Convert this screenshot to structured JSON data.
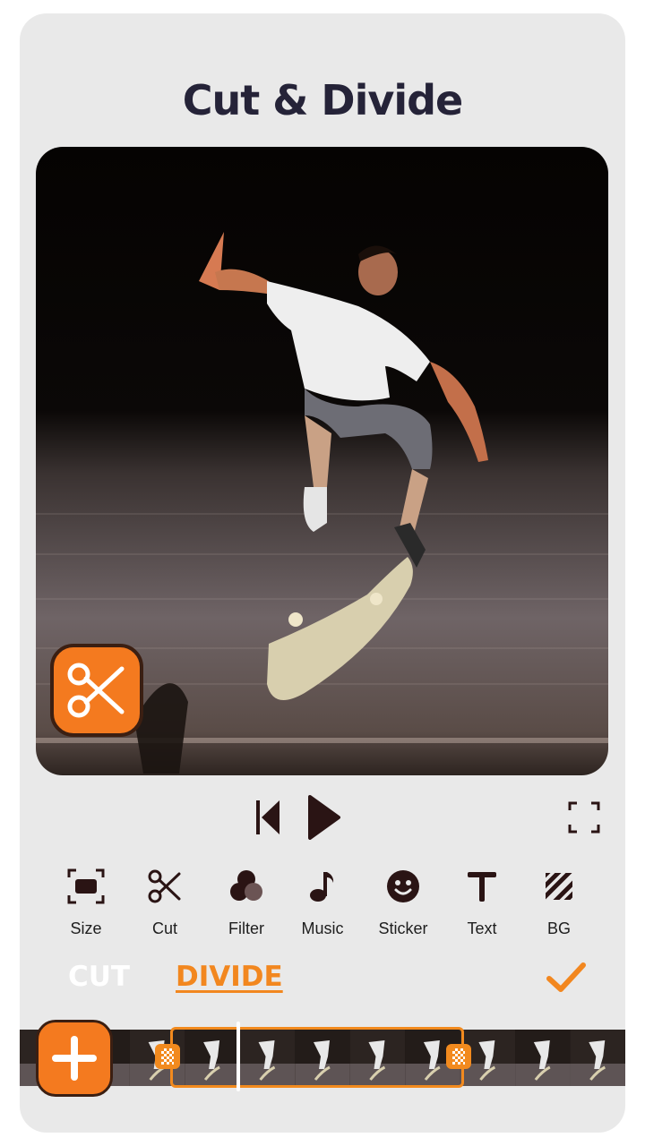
{
  "screen": {
    "title": "Cut & Divide"
  },
  "player": {
    "prev_icon": "skip-previous-icon",
    "play_icon": "play-icon",
    "fullscreen_icon": "fullscreen-icon"
  },
  "tools": [
    {
      "label": "Size",
      "icon": "size-icon"
    },
    {
      "label": "Cut",
      "icon": "scissors-icon"
    },
    {
      "label": "Filter",
      "icon": "filter-icon"
    },
    {
      "label": "Music",
      "icon": "music-note-icon"
    },
    {
      "label": "Sticker",
      "icon": "smiley-icon"
    },
    {
      "label": "Text",
      "icon": "text-icon"
    },
    {
      "label": "BG",
      "icon": "background-icon"
    }
  ],
  "modes": {
    "cut": "CUT",
    "divide": "DIVIDE",
    "active": "DIVIDE"
  },
  "colors": {
    "accent": "#f2871f",
    "title": "#252338",
    "panel": "#e9e9e9",
    "icon_dark": "#2a1414"
  },
  "timeline": {
    "frame_count": 11
  }
}
